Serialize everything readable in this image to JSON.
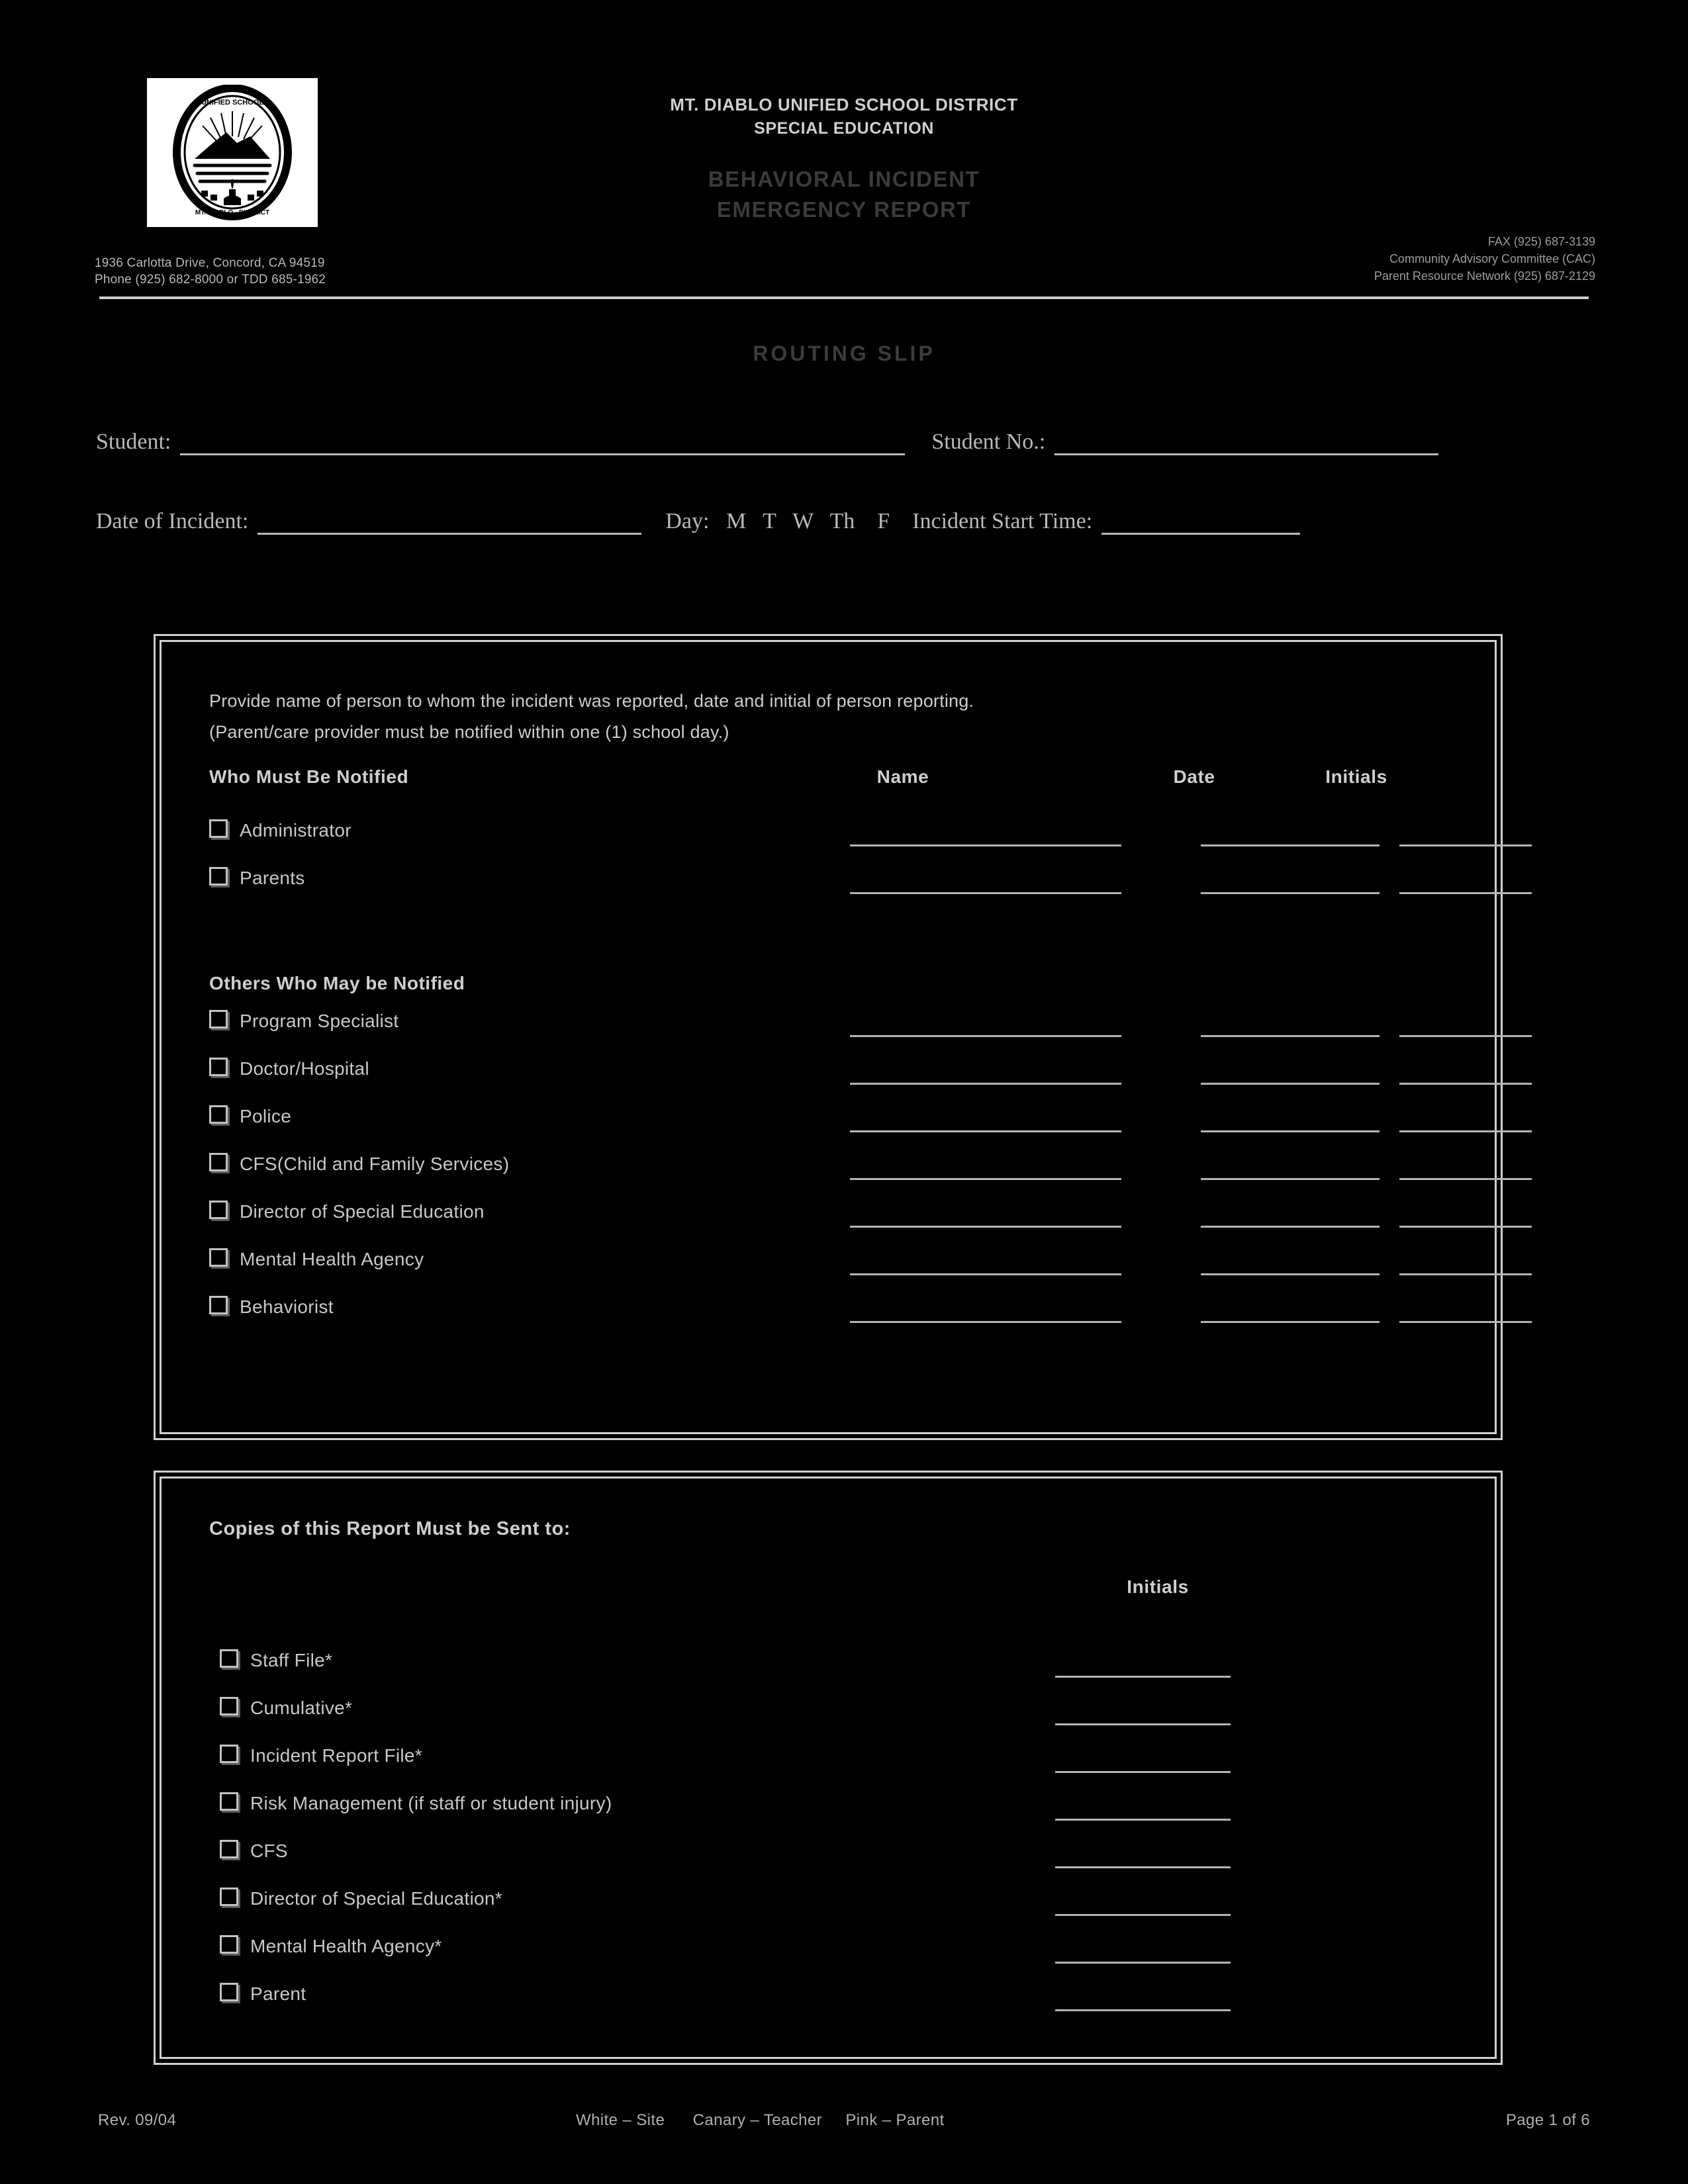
{
  "header": {
    "district": "MT. DIABLO UNIFIED SCHOOL DISTRICT",
    "department": "SPECIAL EDUCATION",
    "title_line1": "BEHAVIORAL INCIDENT",
    "title_line2": "EMERGENCY  REPORT",
    "address_line1": "1936 Carlotta Drive, Concord, CA 94519",
    "address_line2": "Phone (925) 682-8000 or TDD 685-1962",
    "contact_line1": "FAX  (925) 687-3139",
    "contact_line2": "Community Advisory Committee (CAC)",
    "contact_line3": "Parent Resource Network (925) 687-2129",
    "logo_alt": "Mt. Diablo Unified School District seal"
  },
  "routing_slip_title": "ROUTING SLIP",
  "student_fields": {
    "student_label": "Student:",
    "student_value": "",
    "student_no_label": "Student No.:",
    "student_no_value": "",
    "date_of_incident_label": "Date of Incident:",
    "date_of_incident_value": "",
    "day_label": "Day:   M   T   W   Th    F",
    "incident_start_time_label": "Incident Start Time:",
    "incident_start_time_value": ""
  },
  "notify_box": {
    "intro_line1": "Provide name of person to whom the incident was reported, date and initial of person reporting.",
    "intro_line2": "(Parent/care provider must be notified within one (1) school day.)",
    "columns": {
      "who": "Who Must Be Notified",
      "name": "Name",
      "date": "Date",
      "initials": "Initials"
    },
    "must_notify": [
      {
        "label": "Administrator",
        "name": "",
        "date": "",
        "initials": ""
      },
      {
        "label": "Parents",
        "name": "",
        "date": "",
        "initials": ""
      }
    ],
    "others_heading": "Others Who May be Notified",
    "others": [
      {
        "label": "Program Specialist",
        "name": "",
        "date": "",
        "initials": ""
      },
      {
        "label": "Doctor/Hospital",
        "name": "",
        "date": "",
        "initials": ""
      },
      {
        "label": "Police",
        "name": "",
        "date": "",
        "initials": ""
      },
      {
        "label": "CFS(Child and Family Services)",
        "name": "",
        "date": "",
        "initials": ""
      },
      {
        "label": "Director of Special Education",
        "name": "",
        "date": "",
        "initials": ""
      },
      {
        "label": "Mental Health Agency",
        "name": "",
        "date": "",
        "initials": ""
      },
      {
        "label": "Behaviorist",
        "name": "",
        "date": "",
        "initials": ""
      }
    ]
  },
  "copies_box": {
    "heading": "Copies of this Report Must be Sent to:",
    "initials_column": "Initials",
    "items": [
      {
        "label": "Staff File*",
        "initials": ""
      },
      {
        "label": "Cumulative*",
        "initials": ""
      },
      {
        "label": "Incident Report File*",
        "initials": ""
      },
      {
        "label": "Risk Management (if staff or student injury)",
        "initials": ""
      },
      {
        "label": "CFS",
        "initials": ""
      },
      {
        "label": "Director of Special Education*",
        "initials": ""
      },
      {
        "label": "Mental Health Agency*",
        "initials": ""
      },
      {
        "label": "Parent",
        "initials": ""
      }
    ]
  },
  "footer": {
    "revision": "Rev. 09/04",
    "copy_distribution": "White – Site      Canary – Teacher     Pink – Parent",
    "page": "Page 1 of 6"
  },
  "colors": {
    "background": "#000000",
    "text": "#c8c8c8",
    "heading_dim": "#3c3c3c",
    "rule": "#cfcfcf"
  }
}
